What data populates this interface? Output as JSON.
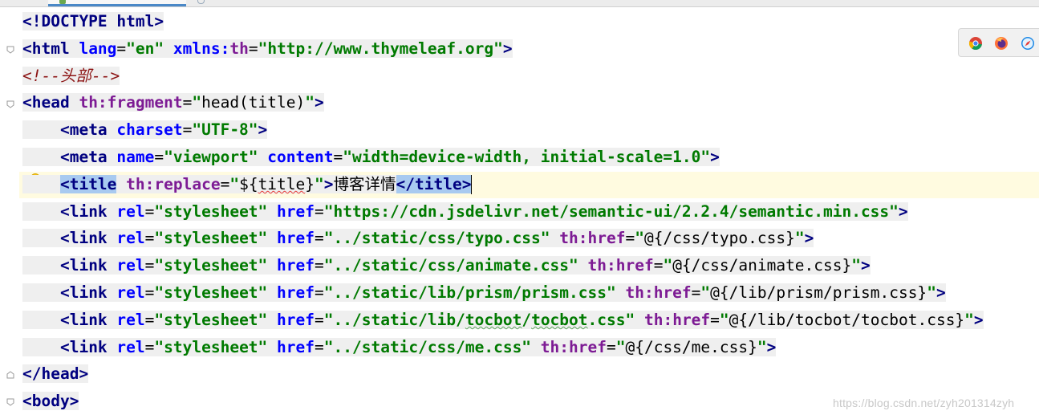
{
  "editor": {
    "lines": [
      [
        {
          "c": "tag",
          "t": "<!DOCTYPE html>"
        }
      ],
      [
        {
          "c": "tag",
          "t": "<html "
        },
        {
          "c": "attrn",
          "t": "lang"
        },
        {
          "c": "txt",
          "t": "="
        },
        {
          "c": "val",
          "t": "\"en\""
        },
        {
          "c": "txt",
          "t": " "
        },
        {
          "c": "attrn",
          "t": "xmlns:"
        },
        {
          "c": "attr",
          "t": "th"
        },
        {
          "c": "txt",
          "t": "="
        },
        {
          "c": "val",
          "t": "\"http://www.thymeleaf.org\""
        },
        {
          "c": "tag",
          "t": ">"
        }
      ],
      [
        {
          "c": "cmt",
          "t": "<!--头部-->"
        }
      ],
      [
        {
          "c": "tag",
          "t": "<head "
        },
        {
          "c": "attr",
          "t": "th:fragment"
        },
        {
          "c": "txt",
          "t": "="
        },
        {
          "c": "val",
          "t": "\""
        },
        {
          "c": "txt",
          "t": "head(title)"
        },
        {
          "c": "val",
          "t": "\""
        },
        {
          "c": "tag",
          "t": ">"
        }
      ],
      [
        {
          "c": "txt",
          "t": "    "
        },
        {
          "c": "tag",
          "t": "<meta "
        },
        {
          "c": "attrn",
          "t": "charset"
        },
        {
          "c": "txt",
          "t": "="
        },
        {
          "c": "val",
          "t": "\"UTF-8\""
        },
        {
          "c": "tag",
          "t": ">"
        }
      ],
      [
        {
          "c": "txt",
          "t": "    "
        },
        {
          "c": "tag",
          "t": "<meta "
        },
        {
          "c": "attrn",
          "t": "name"
        },
        {
          "c": "txt",
          "t": "="
        },
        {
          "c": "val",
          "t": "\"viewport\""
        },
        {
          "c": "txt",
          "t": " "
        },
        {
          "c": "attrn",
          "t": "content"
        },
        {
          "c": "txt",
          "t": "="
        },
        {
          "c": "val",
          "t": "\"width=device-width, initial-scale=1.0\""
        },
        {
          "c": "tag",
          "t": ">"
        }
      ],
      [
        {
          "c": "txt",
          "t": "    "
        },
        {
          "c": "tag sel",
          "t": "<title"
        },
        {
          "c": "txt",
          "t": " "
        },
        {
          "c": "attr",
          "t": "th:replace"
        },
        {
          "c": "txt",
          "t": "="
        },
        {
          "c": "val",
          "t": "\""
        },
        {
          "c": "txt",
          "t": "${"
        },
        {
          "c": "txt ul-red",
          "t": "title"
        },
        {
          "c": "txt",
          "t": "}"
        },
        {
          "c": "val",
          "t": "\""
        },
        {
          "c": "tag",
          "t": ">"
        },
        {
          "c": "txt",
          "t": "博客详情"
        },
        {
          "c": "tag sel",
          "t": "</title>"
        },
        {
          "c": "cursor",
          "t": ""
        }
      ],
      [
        {
          "c": "txt",
          "t": "    "
        },
        {
          "c": "tag",
          "t": "<link "
        },
        {
          "c": "attrn",
          "t": "rel"
        },
        {
          "c": "txt",
          "t": "="
        },
        {
          "c": "val",
          "t": "\"stylesheet\""
        },
        {
          "c": "txt",
          "t": " "
        },
        {
          "c": "attrn",
          "t": "href"
        },
        {
          "c": "txt",
          "t": "="
        },
        {
          "c": "val",
          "t": "\"https://cdn.jsdelivr.net/semantic-ui/2.2.4/semantic.min.css\""
        },
        {
          "c": "tag",
          "t": ">"
        }
      ],
      [
        {
          "c": "txt",
          "t": "    "
        },
        {
          "c": "tag",
          "t": "<link "
        },
        {
          "c": "attrn",
          "t": "rel"
        },
        {
          "c": "txt",
          "t": "="
        },
        {
          "c": "val",
          "t": "\"stylesheet\""
        },
        {
          "c": "txt",
          "t": " "
        },
        {
          "c": "attrn",
          "t": "href"
        },
        {
          "c": "txt",
          "t": "="
        },
        {
          "c": "val",
          "t": "\"../static/css/typo.css\""
        },
        {
          "c": "txt",
          "t": " "
        },
        {
          "c": "attr",
          "t": "th:href"
        },
        {
          "c": "txt",
          "t": "="
        },
        {
          "c": "val",
          "t": "\""
        },
        {
          "c": "txt",
          "t": "@{/css/typo.css}"
        },
        {
          "c": "val",
          "t": "\""
        },
        {
          "c": "tag",
          "t": ">"
        }
      ],
      [
        {
          "c": "txt",
          "t": "    "
        },
        {
          "c": "tag",
          "t": "<link "
        },
        {
          "c": "attrn",
          "t": "rel"
        },
        {
          "c": "txt",
          "t": "="
        },
        {
          "c": "val",
          "t": "\"stylesheet\""
        },
        {
          "c": "txt",
          "t": " "
        },
        {
          "c": "attrn",
          "t": "href"
        },
        {
          "c": "txt",
          "t": "="
        },
        {
          "c": "val",
          "t": "\"../static/css/animate.css\""
        },
        {
          "c": "txt",
          "t": " "
        },
        {
          "c": "attr",
          "t": "th:href"
        },
        {
          "c": "txt",
          "t": "="
        },
        {
          "c": "val",
          "t": "\""
        },
        {
          "c": "txt",
          "t": "@{/css/animate.css}"
        },
        {
          "c": "val",
          "t": "\""
        },
        {
          "c": "tag",
          "t": ">"
        }
      ],
      [
        {
          "c": "txt",
          "t": "    "
        },
        {
          "c": "tag",
          "t": "<link "
        },
        {
          "c": "attrn",
          "t": "rel"
        },
        {
          "c": "txt",
          "t": "="
        },
        {
          "c": "val",
          "t": "\"stylesheet\""
        },
        {
          "c": "txt",
          "t": " "
        },
        {
          "c": "attrn",
          "t": "href"
        },
        {
          "c": "txt",
          "t": "="
        },
        {
          "c": "val",
          "t": "\"../static/lib/prism/prism.css\""
        },
        {
          "c": "txt",
          "t": " "
        },
        {
          "c": "attr",
          "t": "th:href"
        },
        {
          "c": "txt",
          "t": "="
        },
        {
          "c": "val",
          "t": "\""
        },
        {
          "c": "txt",
          "t": "@{/lib/prism/prism.css}"
        },
        {
          "c": "val",
          "t": "\""
        },
        {
          "c": "tag",
          "t": ">"
        }
      ],
      [
        {
          "c": "txt",
          "t": "    "
        },
        {
          "c": "tag",
          "t": "<link "
        },
        {
          "c": "attrn",
          "t": "rel"
        },
        {
          "c": "txt",
          "t": "="
        },
        {
          "c": "val",
          "t": "\"stylesheet\""
        },
        {
          "c": "txt",
          "t": " "
        },
        {
          "c": "attrn",
          "t": "href"
        },
        {
          "c": "txt",
          "t": "="
        },
        {
          "c": "val",
          "t": "\"../static/lib/"
        },
        {
          "c": "val ul-green",
          "t": "tocbot"
        },
        {
          "c": "val",
          "t": "/"
        },
        {
          "c": "val ul-green",
          "t": "tocbot"
        },
        {
          "c": "val",
          "t": ".css\""
        },
        {
          "c": "txt",
          "t": " "
        },
        {
          "c": "attr",
          "t": "th:href"
        },
        {
          "c": "txt",
          "t": "="
        },
        {
          "c": "val",
          "t": "\""
        },
        {
          "c": "txt",
          "t": "@{/lib/tocbot/tocbot.css}"
        },
        {
          "c": "val",
          "t": "\""
        },
        {
          "c": "tag",
          "t": ">"
        }
      ],
      [
        {
          "c": "txt",
          "t": "    "
        },
        {
          "c": "tag",
          "t": "<link "
        },
        {
          "c": "attrn",
          "t": "rel"
        },
        {
          "c": "txt",
          "t": "="
        },
        {
          "c": "val",
          "t": "\"stylesheet\""
        },
        {
          "c": "txt",
          "t": " "
        },
        {
          "c": "attrn",
          "t": "href"
        },
        {
          "c": "txt",
          "t": "="
        },
        {
          "c": "val",
          "t": "\"../static/css/me.css\""
        },
        {
          "c": "txt",
          "t": " "
        },
        {
          "c": "attr",
          "t": "th:href"
        },
        {
          "c": "txt",
          "t": "="
        },
        {
          "c": "val",
          "t": "\""
        },
        {
          "c": "txt",
          "t": "@{/css/me.css}"
        },
        {
          "c": "val",
          "t": "\""
        },
        {
          "c": "tag",
          "t": ">"
        }
      ],
      [
        {
          "c": "tag",
          "t": "</head>"
        }
      ],
      [
        {
          "c": "tag",
          "t": "<body>"
        }
      ]
    ]
  },
  "browser_icons": [
    "chrome-icon",
    "firefox-icon",
    "safari-icon"
  ],
  "watermark": "https://blog.csdn.net/zyh201314zyh",
  "colors": {
    "tag": "#000080",
    "attribute": "#0000ff",
    "thymeleaf_attribute": "#7d1b94",
    "value": "#007a00",
    "comment": "#8c1414",
    "selection": "#a8caf0",
    "caret_line": "#fffbe0"
  }
}
